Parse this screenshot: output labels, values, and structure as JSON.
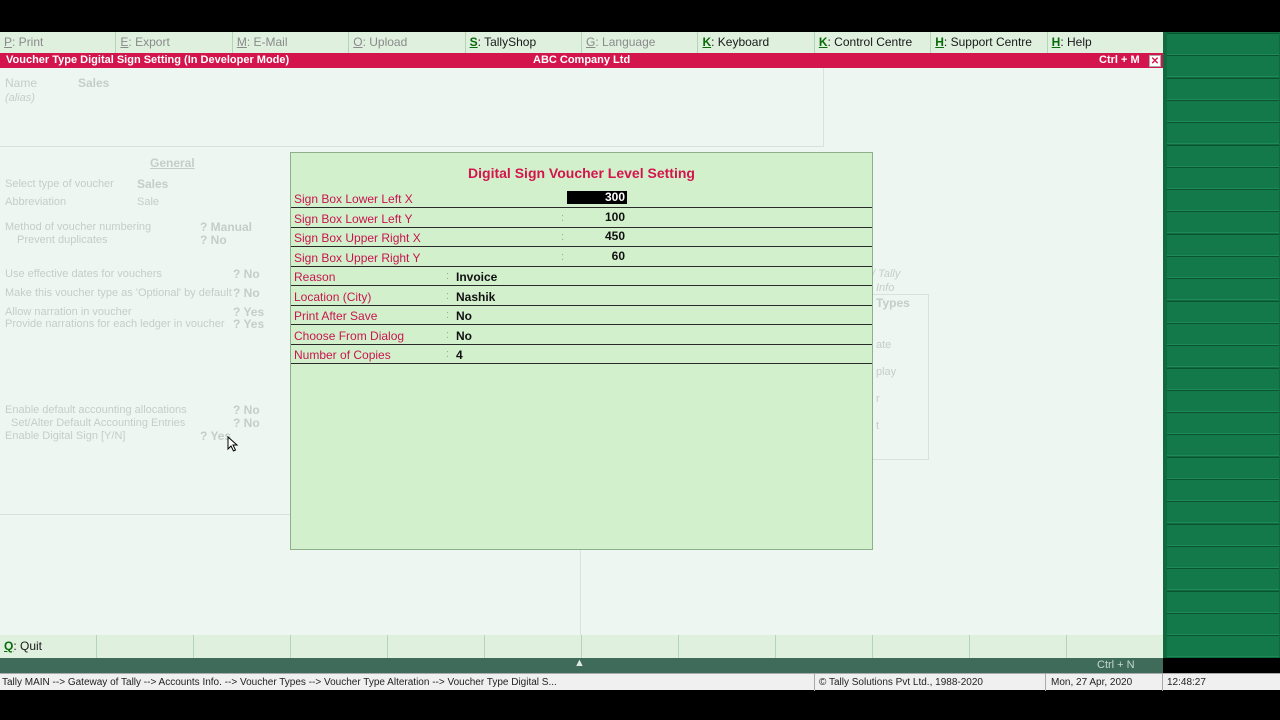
{
  "toolbar": [
    {
      "key": "P",
      "label": ": Print",
      "enabled": false
    },
    {
      "key": "E",
      "label": ": Export",
      "enabled": false
    },
    {
      "key": "M",
      "label": ": E-Mail",
      "enabled": false
    },
    {
      "key": "O",
      "label": ": Upload",
      "enabled": false
    },
    {
      "key": "S",
      "label": ": TallyShop",
      "enabled": true
    },
    {
      "key": "G",
      "label": ": Language",
      "enabled": false
    },
    {
      "key": "K",
      "label": ": Keyboard",
      "enabled": true
    },
    {
      "key": "K",
      "label": ": Control Centre",
      "enabled": true
    },
    {
      "key": "H",
      "label": ": Support Centre",
      "enabled": true
    },
    {
      "key": "H",
      "label": ": Help",
      "enabled": true
    }
  ],
  "titlebar": {
    "left": "Voucher Type Digital Sign Setting (In Developer Mode)",
    "center": "ABC Company Ltd",
    "right": "Ctrl + M",
    "close": "✕"
  },
  "background": {
    "name_label": "Name",
    "name_value": "Sales",
    "alias": "(alias)",
    "general": "General",
    "select_type_label": "Select type of voucher",
    "select_type_value": "Sales",
    "abbreviation_label": "Abbreviation",
    "abbreviation_value": "Sale",
    "numbering_label": "Method of voucher numbering",
    "numbering_value": "? Manual",
    "prevent_dup_label": "Prevent duplicates",
    "prevent_dup_value": "? No",
    "eff_dates_label": "Use effective dates for vouchers",
    "eff_dates_value": "? No",
    "optional_label": "Make this voucher type as 'Optional' by default",
    "optional_value": "? No",
    "narration_label": "Allow narration in voucher",
    "narration_value": "? Yes",
    "narr_ledger_label": "Provide narrations for each ledger in voucher",
    "narr_ledger_value": "? Yes",
    "default_alloc_label": "Enable default accounting allocations",
    "default_alloc_value": "? No",
    "set_alter_label": "Set/Alter Default Accounting Entries",
    "set_alter_value": "? No",
    "digital_sign_label": "Enable Digital Sign [Y/N]",
    "digital_sign_value": "? Yes",
    "right_types": "Types",
    "right_tally": "/ Tally",
    "right_info": "Info",
    "right_ate": "ate",
    "right_play": "play",
    "right_r": "r",
    "right_t": "t"
  },
  "dialog": {
    "title": "Digital Sign Voucher Level Setting",
    "rows": [
      {
        "label": "Sign Box Lower Left X",
        "colon": "",
        "value": "300",
        "numeric": true
      },
      {
        "label": "Sign Box Lower Left Y",
        "colon": ":",
        "value": "100",
        "numeric": true
      },
      {
        "label": "Sign Box Upper Right X",
        "colon": ":",
        "value": "450",
        "numeric": true
      },
      {
        "label": "Sign Box Upper Right Y",
        "colon": ":",
        "value": "60",
        "numeric": true
      },
      {
        "label": "Reason",
        "colon": ":",
        "value": "Invoice",
        "numeric": false
      },
      {
        "label": "Location (City)",
        "colon": ":",
        "value": "Nashik",
        "numeric": false
      },
      {
        "label": "Print After Save",
        "colon": ":",
        "value": "No",
        "numeric": false
      },
      {
        "label": "Choose From Dialog",
        "colon": ":",
        "value": "No",
        "numeric": false
      },
      {
        "label": "Number of Copies",
        "colon": ":",
        "value": "4",
        "numeric": false
      }
    ]
  },
  "bottombar": {
    "quit_key": "Q",
    "quit_label": ": Quit"
  },
  "ctrlbar": {
    "chevron": "▲",
    "right": "Ctrl + N"
  },
  "statusbar": {
    "breadcrumb": "Tally MAIN --> Gateway of Tally --> Accounts Info. --> Voucher Types --> Voucher Type Alteration --> Voucher Type Digital S...",
    "copyright": "© Tally Solutions Pvt Ltd., 1988-2020",
    "date": "Mon, 27 Apr, 2020",
    "time": "12:48:27"
  }
}
